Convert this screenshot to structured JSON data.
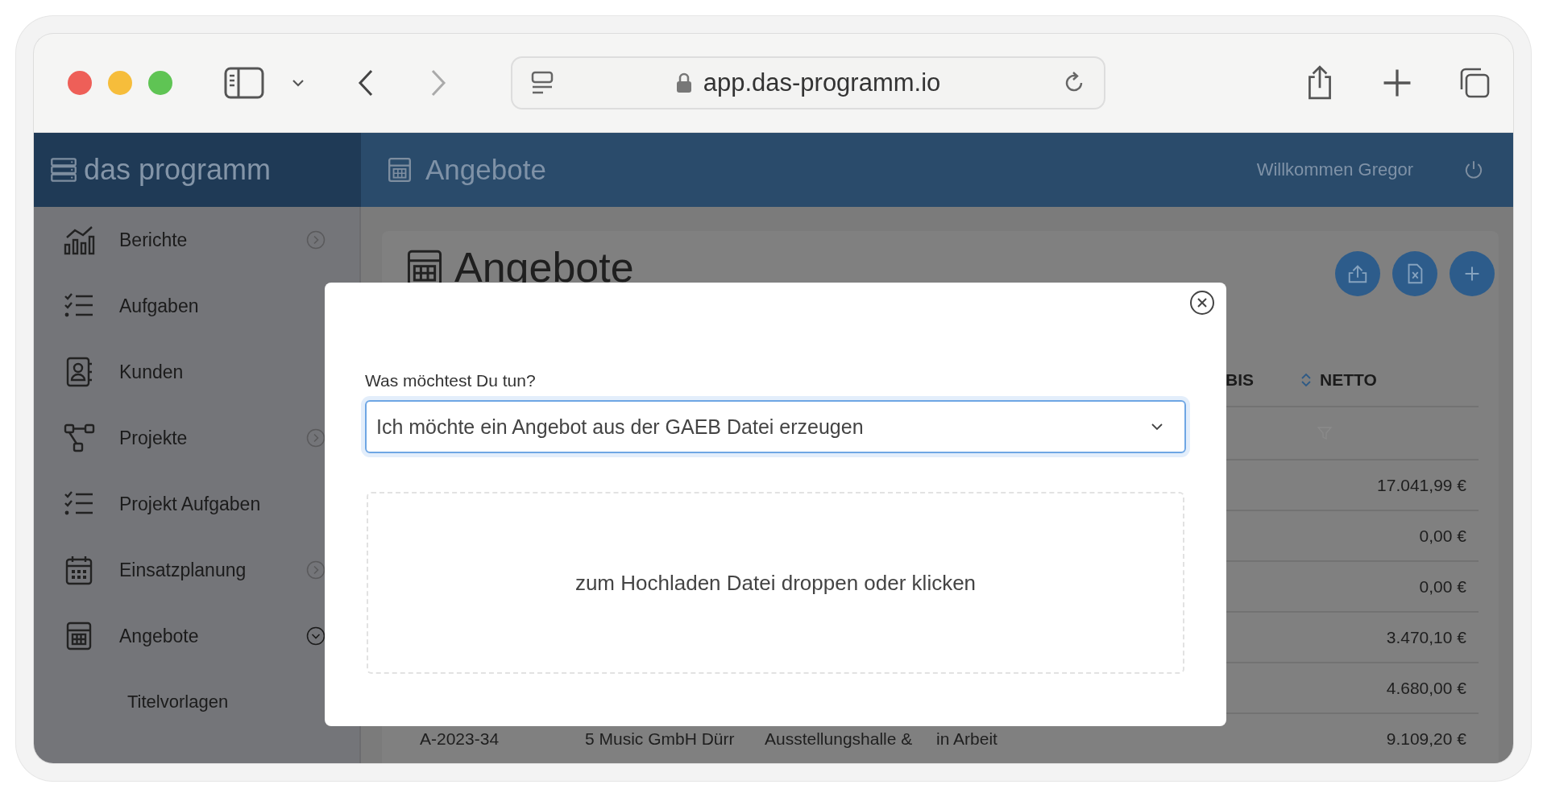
{
  "browser": {
    "url": "app.das-programm.io"
  },
  "app": {
    "brand": "das programm",
    "header_title": "Angebote",
    "welcome": "Willkommen Gregor"
  },
  "sidebar": {
    "items": [
      {
        "label": "Berichte",
        "expanded": false
      },
      {
        "label": "Aufgaben"
      },
      {
        "label": "Kunden"
      },
      {
        "label": "Projekte",
        "expanded": false
      },
      {
        "label": "Projekt Aufgaben"
      },
      {
        "label": "Einsatzplanung",
        "expanded": false
      },
      {
        "label": "Angebote",
        "expanded": true,
        "children": [
          {
            "label": "Titelvorlagen"
          }
        ]
      }
    ]
  },
  "page": {
    "title": "Angebote"
  },
  "table": {
    "columns": [
      "BIS",
      "NETTO"
    ],
    "rows": [
      {
        "netto": "17.041,99 €"
      },
      {
        "netto": "0,00 €"
      },
      {
        "netto": "0,00 €"
      },
      {
        "netto": "3.470,10 €"
      },
      {
        "netto": "4.680,00 €"
      },
      {
        "column_1": "A-2023-34",
        "column_2": "5 Music GmbH Dürr",
        "column_3": "Ausstellungshalle &",
        "column_4": "in Arbeit",
        "netto": "9.109,20 €"
      }
    ]
  },
  "modal": {
    "label": "Was möchtest Du tun?",
    "select_value": "Ich möchte ein Angebot aus der GAEB Datei erzeugen",
    "dropzone_text": "zum Hochladen Datei droppen oder klicken"
  }
}
